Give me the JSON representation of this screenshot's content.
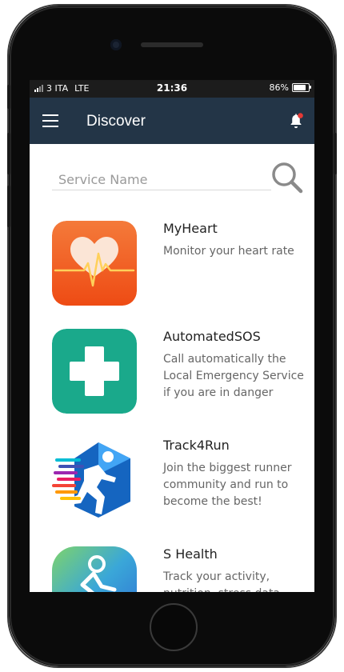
{
  "status_bar": {
    "carrier": "3 ITA",
    "network": "LTE",
    "time": "21:36",
    "battery": "86%",
    "battery_level": 0.86
  },
  "app_bar": {
    "title": "Discover",
    "menu_icon": "menu-icon",
    "notification_icon": "bell-icon",
    "notification_badge_color": "#e53935",
    "color": "#233547"
  },
  "search": {
    "placeholder": "Service Name",
    "value": "",
    "icon": "search-icon"
  },
  "services": [
    {
      "name": "MyHeart",
      "description": "Monitor your heart rate",
      "icon": "heart-rate-icon",
      "color": "#f0621f"
    },
    {
      "name": "AutomatedSOS",
      "description": "Call automatically the Local Emergency Service if you are in danger",
      "icon": "medical-cross-icon",
      "color": "#1aa98b"
    },
    {
      "name": "Track4Run",
      "description": "Join the biggest runner community and run to become the best!",
      "icon": "runner-icon",
      "color": "#1565c0"
    },
    {
      "name": "S Health",
      "description": "Track your activity, nutrition, stress data...",
      "icon": "s-health-runner-icon",
      "color": "#3aa7d8"
    }
  ]
}
